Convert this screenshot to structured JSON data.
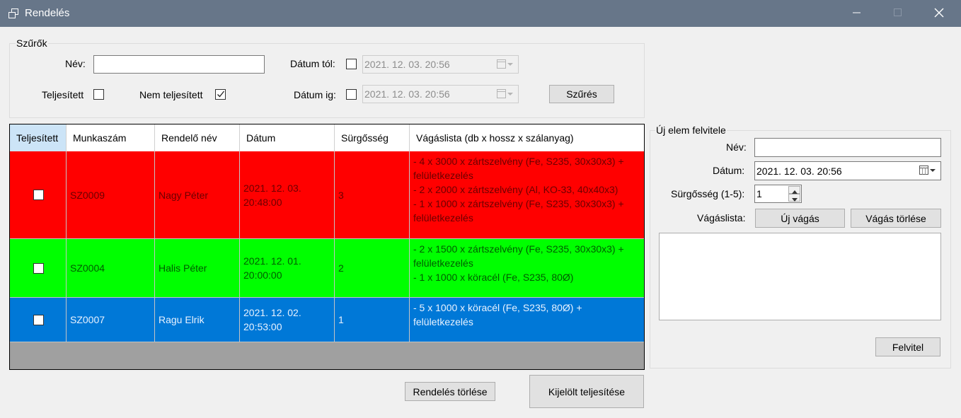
{
  "window": {
    "title": "Rendelés"
  },
  "filters": {
    "group_label": "Szűrők",
    "name_label": "Név:",
    "name_value": "",
    "completed_label": "Teljesített",
    "completed_checked": false,
    "not_completed_label": "Nem teljesített",
    "not_completed_checked": true,
    "date_from_label": "Dátum tól:",
    "date_from_enabled": false,
    "date_from_value": "2021. 12. 03. 20:56",
    "date_to_label": "Dátum ig:",
    "date_to_enabled": false,
    "date_to_value": "2021. 12. 03. 20:56",
    "filter_button": "Szűrés"
  },
  "grid": {
    "columns": [
      "Teljesített",
      "Munkaszám",
      "Rendelő név",
      "Dátum",
      "Sürgősség",
      "Vágáslista (db x hossz x szálanyag)"
    ],
    "rows": [
      {
        "completed": false,
        "work_number": "SZ0009",
        "customer": "Nagy Péter",
        "date": "2021. 12. 03.\n20:48:00",
        "urgency": "3",
        "cut_list": "- 4 x 3000 x zártszelvény (Fe, S235, 30x30x3) +\nfelületkezelés\n- 2 x 2000 x zártszelvény (Al, KO-33, 40x40x3)\n- 1 x 1000 x zártszelvény (Fe, S235, 30x30x3) +\nfelületkezelés",
        "color": "#ff0000"
      },
      {
        "completed": false,
        "work_number": "SZ0004",
        "customer": "Halis Péter",
        "date": "2021. 12. 01.\n20:00:00",
        "urgency": "2",
        "cut_list": "- 2 x 1500 x zártszelvény (Fe, S235, 30x30x3) +\nfelületkezelés\n- 1 x 1000 x köracél (Fe, S235, 80Ø)",
        "color": "#00ff00"
      },
      {
        "completed": false,
        "work_number": "SZ0007",
        "customer": "Ragu Elrik",
        "date": "2021. 12. 02.\n20:53:00",
        "urgency": "1",
        "cut_list": "- 5 x 1000 x köracél (Fe, S235, 80Ø) +\nfelületkezelés",
        "color": "#0078d7"
      }
    ]
  },
  "bottom": {
    "delete_order_button": "Rendelés törlése",
    "complete_selected_button": "Kijelölt teljesítése"
  },
  "new_item": {
    "group_label": "Új elem felvitele",
    "name_label": "Név:",
    "name_value": "",
    "date_label": "Dátum:",
    "date_value": "2021. 12. 03. 20:56",
    "urgency_label": "Sürgősség (1-5):",
    "urgency_value": "1",
    "cut_list_label": "Vágáslista:",
    "new_cut_button": "Új vágás",
    "delete_cut_button": "Vágás törlése",
    "add_button": "Felvitel"
  },
  "colors": {
    "titlebar": "#677689",
    "row_red": "#ff0000",
    "row_green": "#00ff00",
    "row_blue": "#0078d7",
    "header_selected": "#cce4f7"
  }
}
